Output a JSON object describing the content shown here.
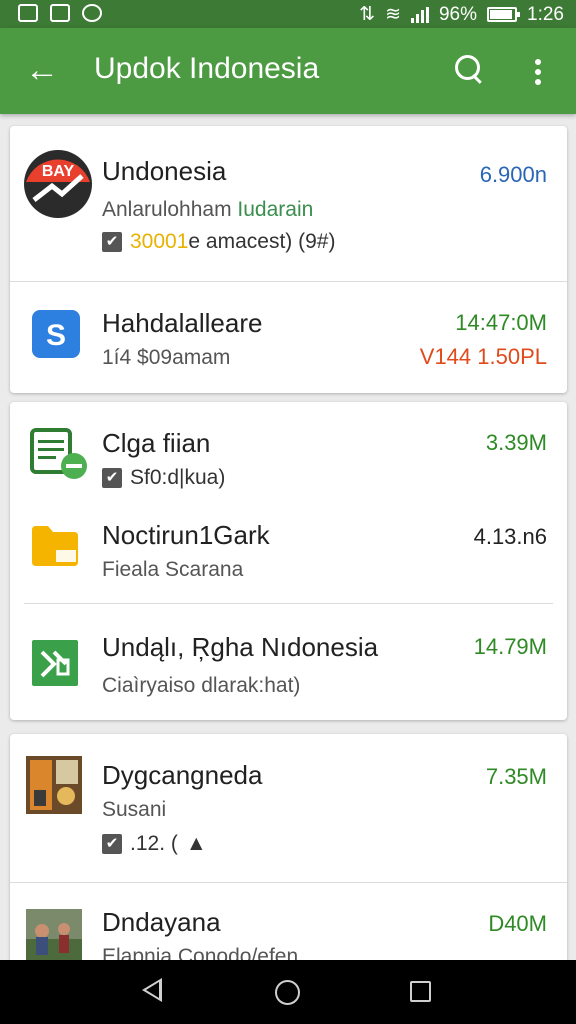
{
  "status_bar": {
    "battery": "96%",
    "time": "1:26",
    "icons": [
      "screenshot-icon",
      "image-icon",
      "sync-icon",
      "vibrate-icon",
      "wifi-icon",
      "signal-icon",
      "battery-icon"
    ]
  },
  "app_bar": {
    "title": "Updok Indonesia",
    "icons": [
      "back-arrow-icon",
      "search-icon",
      "more-vert-icon"
    ]
  },
  "items": [
    {
      "name": "Undonesia",
      "sub_a": "Anlarulohham ",
      "sub_b": "Iudarain",
      "meta_a": "30001",
      "meta_b": "e amacest) (9#)",
      "size": "6.900n",
      "icon": "news-app-icon"
    },
    {
      "name": "Hahdalalleare",
      "sub": "1í4 $09amam",
      "size": "14:47:0M",
      "size2": "V144 1.50PL",
      "icon": "s-app-icon"
    },
    {
      "name": "Clga fiian",
      "meta": "Sf0:d|kua)",
      "size": "3.39M",
      "icon": "sheet-app-icon"
    },
    {
      "name": "Noctirun1Gark",
      "sub": "Fieala Scarana",
      "size": "4.13.n6",
      "icon": "folder-icon"
    },
    {
      "name": "Undąlı, Ŗgha Nıdonesia",
      "sub": "Ciaìryaiso dlarak:hat)",
      "size": "14.79M",
      "icon": "excel-app-icon"
    },
    {
      "name": "Dygcangneda",
      "sub": "Susani",
      "meta": ".12. (",
      "size": "7.35M",
      "icon": "photo-thumbnail-icon"
    },
    {
      "name": "Dndayana",
      "sub": "Elapnia Conodo/efen",
      "size": "D40M",
      "icon": "photo-thumbnail-icon"
    }
  ],
  "colors": {
    "status_bar": "#3d7a35",
    "app_bar": "#4c9a42",
    "size_green": "#2f8a25",
    "size_blue": "#2a66b6",
    "accent_red": "#e04b1c"
  }
}
